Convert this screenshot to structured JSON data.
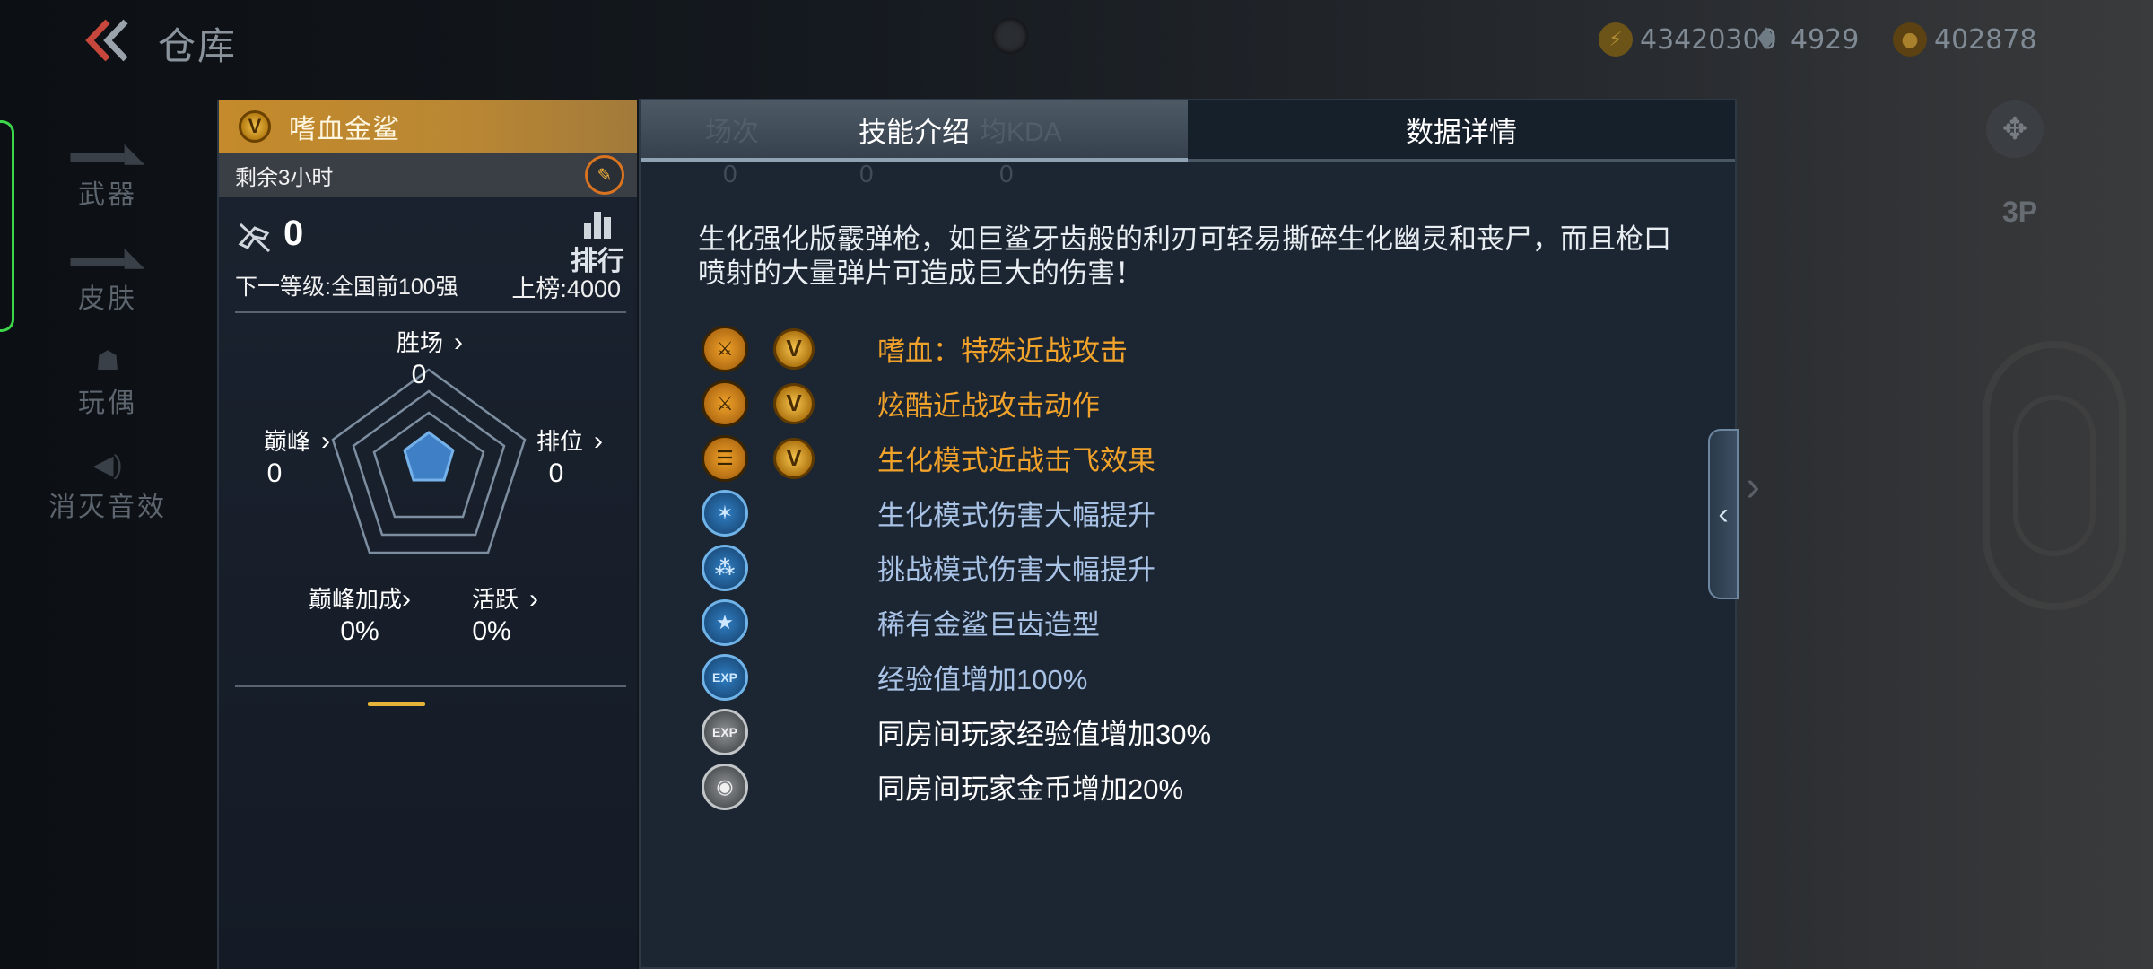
{
  "header": {
    "title": "仓库",
    "currency": [
      {
        "name": "gold",
        "value": "43420300",
        "color": "#b08b31"
      },
      {
        "name": "diamond",
        "value": "4929",
        "color": "#6f7c86"
      },
      {
        "name": "coin",
        "value": "402878",
        "color": "#a9812c"
      }
    ]
  },
  "leftnav": {
    "items": [
      {
        "label": "武器",
        "icon": "rifle-icon",
        "active": true
      },
      {
        "label": "皮肤",
        "icon": "rifle-skin-icon",
        "active": false
      },
      {
        "label": "玩偶",
        "icon": "doll-icon",
        "active": false
      },
      {
        "label": "消灭音效",
        "icon": "speaker-icon",
        "active": false
      }
    ],
    "active_color": "#3cd64a"
  },
  "card": {
    "badge": "V",
    "name": "嗜血金鲨",
    "timer": "剩余3小时",
    "kills": "0",
    "rank_label": "排行",
    "next_level": "下一等级:全国前100强",
    "board_score": "上榜:4000",
    "stats": {
      "wins": {
        "name": "胜场",
        "value": "0"
      },
      "peak": {
        "name": "巅峰",
        "value": "0"
      },
      "ranked": {
        "name": "排位",
        "value": "0"
      },
      "peak_bonus": {
        "name": "巅峰加成",
        "value": "0%"
      },
      "active": {
        "name": "活跃",
        "value": "0%"
      }
    },
    "accent_color": "#c48a2b"
  },
  "panel": {
    "tabs": [
      {
        "label": "技能介绍",
        "active": true
      },
      {
        "label": "数据详情",
        "active": false
      }
    ],
    "ghost_labels": [
      "场次",
      "均KDA"
    ],
    "ghost_values": [
      "0",
      "0",
      "0"
    ],
    "description": "生化强化版霰弹枪，如巨鲨牙齿般的利刃可轻易撕碎生化幽灵和丧尸，而且枪口喷射的大量弹片可造成巨大的伤害！",
    "skills": [
      {
        "text": "嗜血：特殊近战攻击",
        "icon": "melee-blade-icon",
        "style": "gold",
        "vip": true,
        "color": "#f0a22a"
      },
      {
        "text": "炫酷近战攻击动作",
        "icon": "melee-action-icon",
        "style": "gold",
        "vip": true,
        "color": "#f0a22a"
      },
      {
        "text": "生化模式近战击飞效果",
        "icon": "knockback-icon",
        "style": "gold",
        "vip": true,
        "color": "#f0a22a"
      },
      {
        "text": "生化模式伤害大幅提升",
        "icon": "bio-damage-icon",
        "style": "blue",
        "vip": false,
        "color": "#a9c3e6"
      },
      {
        "text": "挑战模式伤害大幅提升",
        "icon": "challenge-damage-icon",
        "style": "blue",
        "vip": false,
        "color": "#a9c3e6"
      },
      {
        "text": "稀有金鲨巨齿造型",
        "icon": "star-icon",
        "style": "blue",
        "vip": false,
        "color": "#a9c3e6"
      },
      {
        "text": "经验值增加100%",
        "icon": "exp-icon",
        "style": "blue",
        "vip": false,
        "color": "#a9c3e6"
      },
      {
        "text": "同房间玩家经验值增加30%",
        "icon": "room-exp-icon",
        "style": "grey",
        "vip": false,
        "color": "#ffffff"
      },
      {
        "text": "同房间玩家金币增加20%",
        "icon": "room-coin-icon",
        "style": "grey",
        "vip": false,
        "color": "#ffffff"
      }
    ]
  },
  "scene": {
    "view_mode": "3P"
  }
}
